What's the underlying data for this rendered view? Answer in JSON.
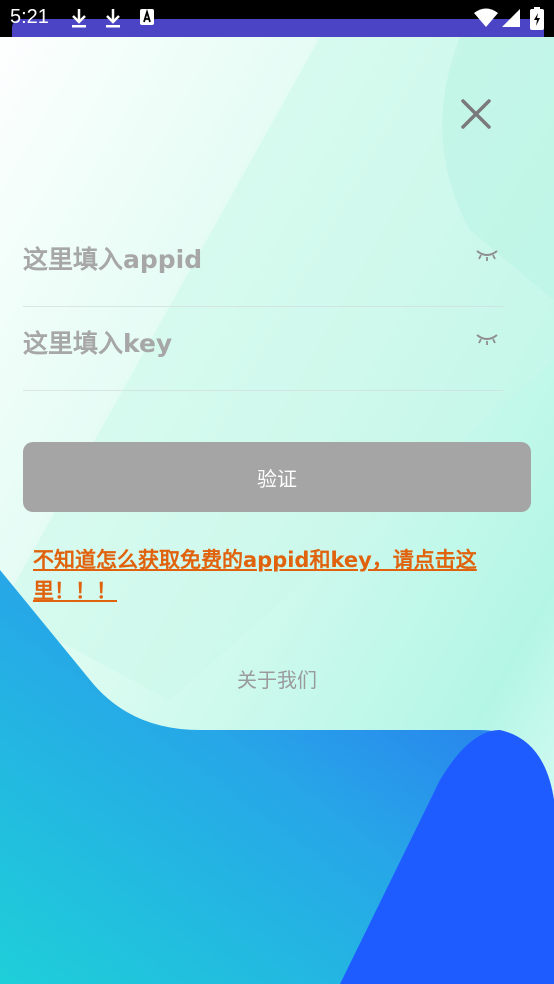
{
  "status_bar": {
    "time": "5:21",
    "icons": [
      "download-icon",
      "download-icon",
      "a-notification-icon",
      "wifi-icon",
      "signal-icon",
      "battery-icon"
    ]
  },
  "colors": {
    "accent_link": "#e0620c",
    "button_bg": "#a5a5a5",
    "wave_blue": "#1f5cff",
    "wave_cyan": "#1ecfd8",
    "status_accent": "#4b44c4"
  },
  "form": {
    "appid_placeholder": "这里填入appid",
    "key_placeholder": "这里填入key",
    "verify_label": "验证"
  },
  "help_link": "不知道怎么获取免费的appid和key，请点击这里！！！",
  "about_label": "关于我们"
}
